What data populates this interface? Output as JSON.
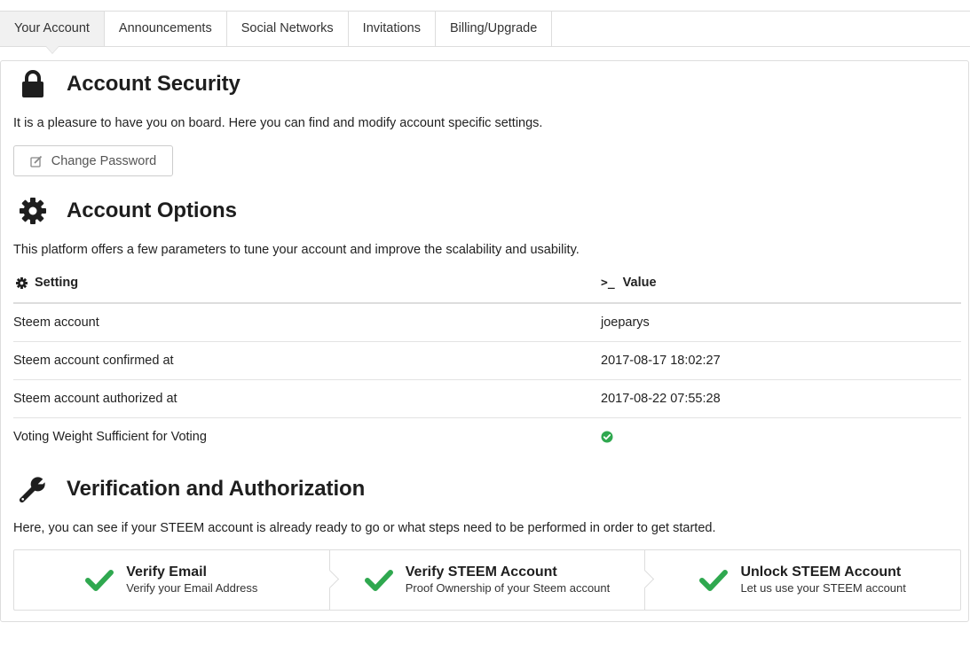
{
  "tabs": [
    {
      "label": "Your Account",
      "active": true
    },
    {
      "label": "Announcements"
    },
    {
      "label": "Social Networks"
    },
    {
      "label": "Invitations"
    },
    {
      "label": "Billing/Upgrade"
    }
  ],
  "security": {
    "title": "Account Security",
    "icon": "lock-icon",
    "description": "It is a pleasure to have you on board. Here you can find and modify account specific settings.",
    "change_password_label": "Change Password"
  },
  "options": {
    "title": "Account Options",
    "icon": "gear-icon",
    "description": "This platform offers a few parameters to tune your account and improve the scalability and usability.",
    "table": {
      "setting_header": "Setting",
      "value_header": "Value",
      "value_header_icon": "terminal-icon",
      "rows": [
        {
          "setting": "Steem account",
          "value": "joeparys"
        },
        {
          "setting": "Steem account confirmed at",
          "value": "2017-08-17 18:02:27"
        },
        {
          "setting": "Steem account authorized at",
          "value": "2017-08-22 07:55:28"
        },
        {
          "setting": "Voting Weight Sufficient for Voting",
          "value_icon": "check-circle-icon"
        }
      ]
    }
  },
  "verification": {
    "title": "Verification and Authorization",
    "icon": "wrench-icon",
    "description": "Here, you can see if your STEEM account is already ready to go or what steps need to be performed in order to get started.",
    "steps": [
      {
        "title": "Verify Email",
        "subtitle": "Verify your Email Address",
        "status": "done"
      },
      {
        "title": "Verify STEEM Account",
        "subtitle": "Proof Ownership of your Steem account",
        "status": "done"
      },
      {
        "title": "Unlock STEEM Account",
        "subtitle": "Let us use your STEEM account",
        "status": "done"
      }
    ]
  },
  "colors": {
    "success": "#2fa84f",
    "border": "#dddddd",
    "active_tab_bg": "#f1f1f1"
  }
}
